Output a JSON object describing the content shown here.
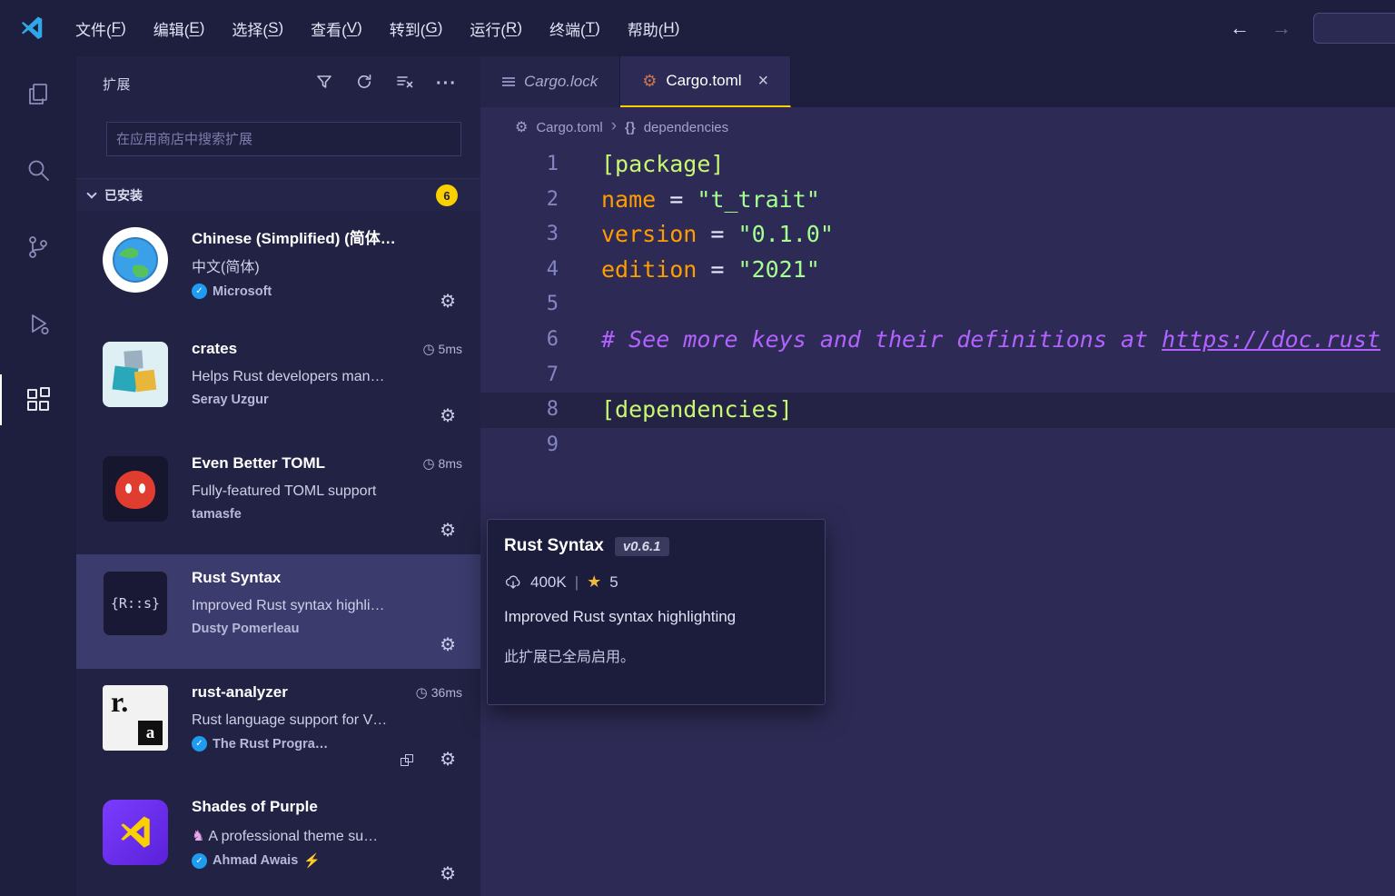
{
  "titlebar": {
    "menus": [
      {
        "pre": "文件(",
        "key": "F",
        "post": ")"
      },
      {
        "pre": "编辑(",
        "key": "E",
        "post": ")"
      },
      {
        "pre": "选择(",
        "key": "S",
        "post": ")"
      },
      {
        "pre": "查看(",
        "key": "V",
        "post": ")"
      },
      {
        "pre": "转到(",
        "key": "G",
        "post": ")"
      },
      {
        "pre": "运行(",
        "key": "R",
        "post": ")"
      },
      {
        "pre": "终端(",
        "key": "T",
        "post": ")"
      },
      {
        "pre": "帮助(",
        "key": "H",
        "post": ")"
      }
    ]
  },
  "nav": {
    "back": "←",
    "forward": "→"
  },
  "sidebar": {
    "title": "扩展",
    "search_placeholder": "在应用商店中搜索扩展",
    "section": {
      "label": "已安装",
      "count": "6"
    },
    "items": [
      {
        "name": "Chinese (Simplified) (简体…",
        "desc": "中文(简体)",
        "publisher": "Microsoft"
      },
      {
        "name": "crates",
        "time": "5ms",
        "desc": "Helps Rust developers man…",
        "publisher": "Seray Uzgur"
      },
      {
        "name": "Even Better TOML",
        "time": "8ms",
        "desc": "Fully-featured TOML support",
        "publisher": "tamasfe"
      },
      {
        "name": "Rust Syntax",
        "desc": "Improved Rust syntax highli…",
        "publisher": "Dusty Pomerleau",
        "icon_text": "{R::s}"
      },
      {
        "name": "rust-analyzer",
        "time": "36ms",
        "desc": "Rust language support for V…",
        "publisher": "The Rust Progra…",
        "icon_top": "r.",
        "icon_bottom": "a"
      },
      {
        "name": "Shades of Purple",
        "desc": "A professional theme su…",
        "publisher": "Ahmad Awais"
      }
    ]
  },
  "editor": {
    "tabs": [
      {
        "label": "Cargo.lock"
      },
      {
        "label": "Cargo.toml"
      }
    ],
    "breadcrumb": {
      "file": "Cargo.toml",
      "symbol_icon": "{}",
      "symbol": "dependencies"
    },
    "code": {
      "lines": [
        {
          "n": "1",
          "tokens": [
            {
              "text": "[package]",
              "type": "header"
            }
          ]
        },
        {
          "n": "2",
          "tokens": [
            {
              "text": "name",
              "type": "key"
            },
            {
              "text": " = ",
              "type": "op"
            },
            {
              "text": "\"t_trait\"",
              "type": "str"
            }
          ]
        },
        {
          "n": "3",
          "tokens": [
            {
              "text": "version",
              "type": "key"
            },
            {
              "text": " = ",
              "type": "op"
            },
            {
              "text": "\"0.1.0\"",
              "type": "str"
            }
          ]
        },
        {
          "n": "4",
          "tokens": [
            {
              "text": "edition",
              "type": "key"
            },
            {
              "text": " = ",
              "type": "op"
            },
            {
              "text": "\"2021\"",
              "type": "str"
            }
          ]
        },
        {
          "n": "5",
          "tokens": []
        },
        {
          "n": "6",
          "tokens": [
            {
              "text": "# See more keys and their definitions at ",
              "type": "comment"
            },
            {
              "text": "https://doc.rust",
              "type": "comment-link"
            }
          ]
        },
        {
          "n": "7",
          "tokens": []
        },
        {
          "n": "8",
          "tokens": [
            {
              "text": "[dependencies]",
              "type": "header"
            }
          ]
        },
        {
          "n": "9",
          "tokens": []
        }
      ]
    }
  },
  "tooltip": {
    "title": "Rust Syntax",
    "version": "v0.6.1",
    "downloads": "400K",
    "separator": "|",
    "rating": "5",
    "description": "Improved Rust syntax highlighting",
    "note": "此扩展已全局启用。"
  },
  "icons": {
    "gear": "⚙",
    "star": "★",
    "clock": "◷",
    "check": "✓",
    "close": "×",
    "more": "···",
    "breadcrumb_chevron": "›",
    "zap": "⚡",
    "unicorn": "♞"
  },
  "colors": {
    "accent": "#FAD000",
    "editor_bg": "#2D2B55",
    "comment": "#B362FF",
    "string": "#A5FF90",
    "keyword": "#FF9D00"
  }
}
